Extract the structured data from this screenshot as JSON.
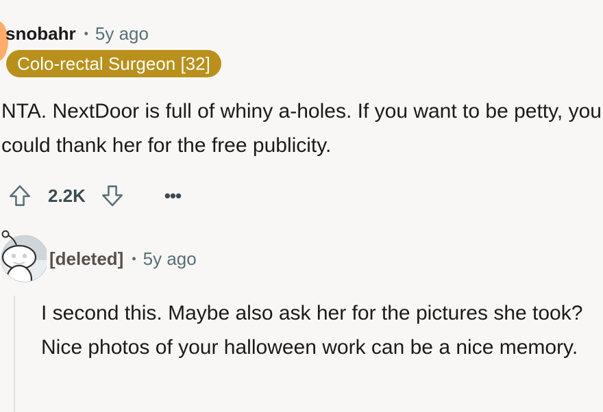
{
  "comments": [
    {
      "author": "snobahr",
      "separator": "•",
      "time": "5y ago",
      "flair": {
        "text": "Colo-rectal Surgeon [32]",
        "background": "#b8901b",
        "color": "#ffffff"
      },
      "avatar_color": "#ffac6b",
      "body": "NTA. NextDoor is full of whiny a-holes. If you want to be petty, you could thank her for the free publicity.",
      "actions": {
        "upvote_icon": "arrow-up-outline-icon",
        "score": "2.2K",
        "downvote_icon": "arrow-down-outline-icon",
        "more_label": "•••",
        "more_icon": "ellipsis-icon"
      }
    },
    {
      "author": "[deleted]",
      "separator": "•",
      "time": "5y ago",
      "avatar_icon": "snoo-icon",
      "body": "I second this. Maybe also ask her for the pictures she took? Nice photos of your halloween work can be a nice memory."
    }
  ],
  "colors": {
    "page_background": "#f9f7f6",
    "text_primary": "#1a1a1b",
    "text_secondary": "#576f76",
    "thread_line": "#e2dfdd"
  }
}
